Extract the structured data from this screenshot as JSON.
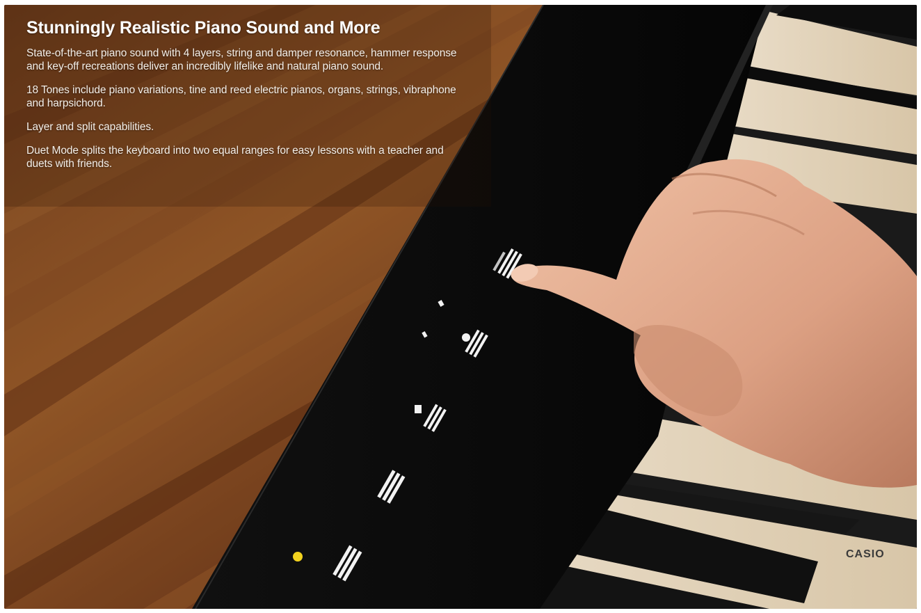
{
  "headline": "Stunningly Realistic Piano Sound and More",
  "paragraphs": [
    "State-of-the-art piano sound with 4 layers, string and damper resonance, hammer response and key-off recreations deliver an incredibly lifelike and natural piano sound.",
    "18 Tones include piano variations, tine and reed electric pianos, organs, strings, vibraphone and harpsichord.",
    "Layer and split capabilities.",
    "Duet Mode splits the keyboard into two equal ranges for easy lessons with a teacher and duets with friends."
  ],
  "brand": "CASIO",
  "colors": {
    "wood_dark": "#5a2e14",
    "wood_light": "#a8612c",
    "panel": "#0b0b0b",
    "white_key": "#efe4d2",
    "black_key": "#141414",
    "skin": "#e0a98a",
    "indicator_led": "#f2d21e"
  }
}
